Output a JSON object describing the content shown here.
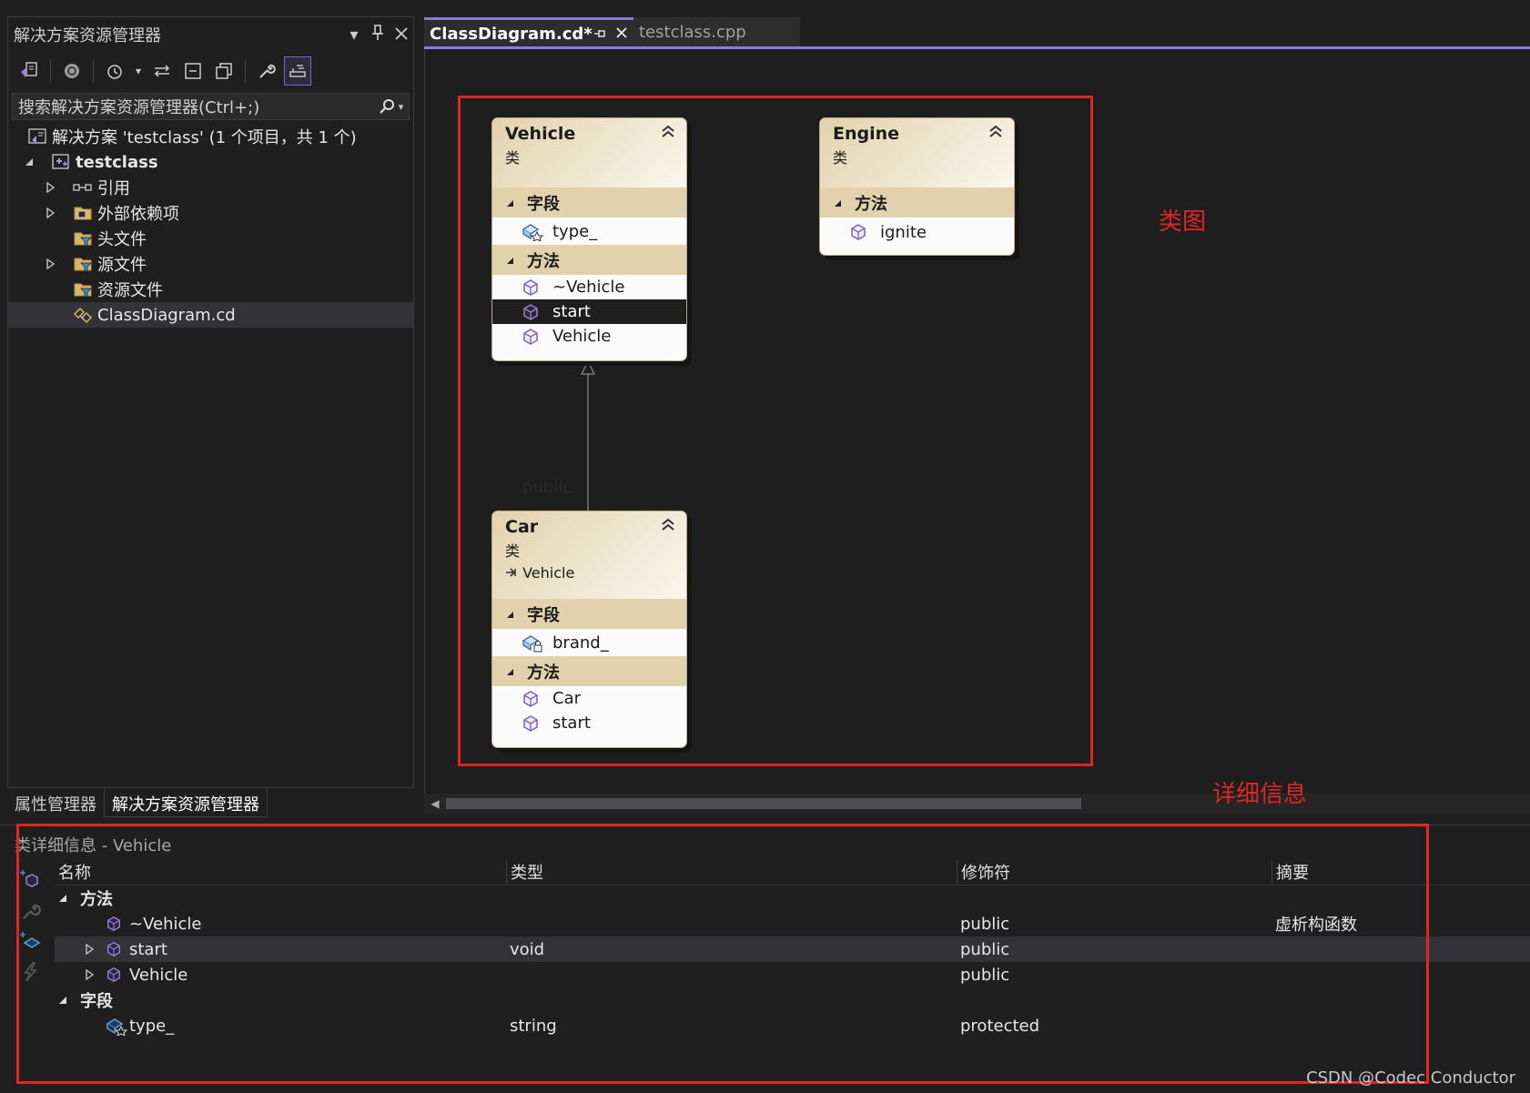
{
  "solution_explorer": {
    "title": "解决方案资源管理器",
    "search_placeholder": "搜索解决方案资源管理器(Ctrl+;)",
    "tree": [
      {
        "label": "解决方案 'testclass' (1 个项目，共 1 个)",
        "icon": "solution-icon"
      },
      {
        "label": "testclass",
        "icon": "cpp-project-icon"
      },
      {
        "label": "引用",
        "icon": "references-icon"
      },
      {
        "label": "外部依赖项",
        "icon": "external-deps-icon"
      },
      {
        "label": "头文件",
        "icon": "filter-folder-icon"
      },
      {
        "label": "源文件",
        "icon": "filter-folder-icon"
      },
      {
        "label": "资源文件",
        "icon": "filter-folder-icon"
      },
      {
        "label": "ClassDiagram.cd",
        "icon": "class-diagram-file-icon"
      }
    ],
    "bottom_tabs": [
      "属性管理器",
      "解决方案资源管理器"
    ]
  },
  "editor": {
    "tabs": [
      {
        "label": "ClassDiagram.cd*",
        "active": true
      },
      {
        "label": "testclass.cpp",
        "active": false
      }
    ],
    "accent_color": "#8c7ad8"
  },
  "annotations": {
    "diagram": "类图",
    "details": "详细信息",
    "color": "#e02525"
  },
  "diagram": {
    "classes": {
      "vehicle": {
        "name": "Vehicle",
        "kind": "类",
        "sections": [
          {
            "title": "字段",
            "members": [
              {
                "name": "type_",
                "icon": "protected-field-icon"
              }
            ]
          },
          {
            "title": "方法",
            "members": [
              {
                "name": "~Vehicle",
                "icon": "method-icon"
              },
              {
                "name": "start",
                "icon": "method-icon",
                "selected": true
              },
              {
                "name": "Vehicle",
                "icon": "method-icon"
              }
            ]
          }
        ]
      },
      "engine": {
        "name": "Engine",
        "kind": "类",
        "sections": [
          {
            "title": "方法",
            "members": [
              {
                "name": "ignite",
                "icon": "method-icon"
              }
            ]
          }
        ]
      },
      "car": {
        "name": "Car",
        "kind": "类",
        "base": "Vehicle",
        "sections": [
          {
            "title": "字段",
            "members": [
              {
                "name": "brand_",
                "icon": "private-field-icon"
              }
            ]
          },
          {
            "title": "方法",
            "members": [
              {
                "name": "Car",
                "icon": "method-icon"
              },
              {
                "name": "start",
                "icon": "method-icon"
              }
            ]
          }
        ]
      }
    },
    "inheritance_label": "public"
  },
  "class_details": {
    "title": "类详细信息 - Vehicle",
    "columns": [
      "名称",
      "类型",
      "修饰符",
      "摘要"
    ],
    "groups": [
      {
        "title": "方法",
        "rows": [
          {
            "name": "~Vehicle",
            "type": "",
            "modifier": "public",
            "summary": "虚析构函数"
          },
          {
            "name": "start",
            "type": "void",
            "modifier": "public",
            "summary": "",
            "selected": true
          },
          {
            "name": "Vehicle",
            "type": "",
            "modifier": "public",
            "summary": ""
          }
        ]
      },
      {
        "title": "字段",
        "rows": [
          {
            "name": "type_",
            "type": "string",
            "modifier": "protected",
            "summary": ""
          }
        ]
      }
    ]
  },
  "watermark": "CSDN @Codec Conductor"
}
